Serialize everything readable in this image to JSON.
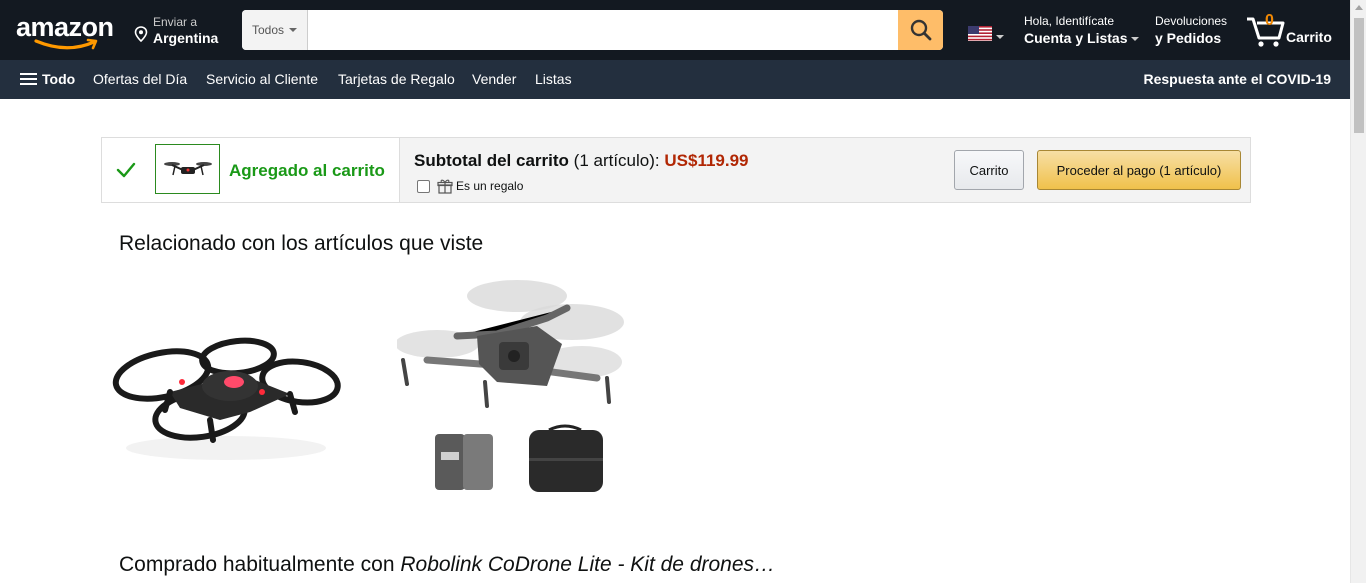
{
  "header": {
    "logo_text": "amazon",
    "deliver_line1": "Enviar a",
    "deliver_line2": "Argentina",
    "search_category": "Todos",
    "search_placeholder": "",
    "account_line1": "Hola, Identifícate",
    "account_line2": "Cuenta y Listas",
    "returns_line1": "Devoluciones",
    "returns_line2": "y Pedidos",
    "cart_count": "0",
    "cart_label": "Carrito"
  },
  "subnav": {
    "all_label": "Todo",
    "items": [
      "Ofertas del Día",
      "Servicio al Cliente",
      "Tarjetas de Regalo",
      "Vender",
      "Listas"
    ],
    "covid_label": "Respuesta ante el COVID-19"
  },
  "added_bar": {
    "added_label": "Agregado al carrito",
    "subtotal_label": "Subtotal del carrito",
    "subtotal_count": "(1 artículo):",
    "subtotal_price": "US$119.99",
    "gift_label": "Es un regalo",
    "cart_button": "Carrito",
    "checkout_button": "Proceder al pago (1 artículo)"
  },
  "sections": {
    "related_title": "Relacionado con los artículos que viste",
    "bought_prefix": "Comprado habitualmente con ",
    "bought_product": "Robolink CoDrone Lite - Kit de drones…"
  },
  "colors": {
    "nav_top": "#131921",
    "nav_sub": "#232f3e",
    "search_button": "#febd69",
    "added_green": "#1a9917",
    "price_red": "#b12704",
    "checkout_yellow": "#f0c14b"
  }
}
